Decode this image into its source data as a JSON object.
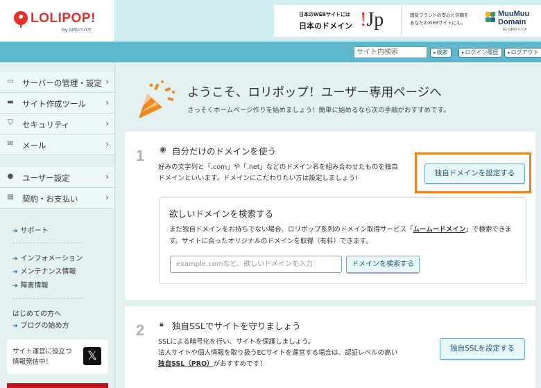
{
  "brand": {
    "logo_text": "LOLIPOP!",
    "logo_sub": "by GMOペパボ"
  },
  "banner": {
    "line1": "日本のWEBサイトには",
    "line2": "日本のドメイン",
    "jp_mark": "!Jp",
    "desc_line1": "国産ブランドの安心と信頼を",
    "desc_line2": "あなたのWEBサイトにも。",
    "sponsor": "MuuMuu Domain",
    "sponsor_sub": "by GMOペパボ"
  },
  "toolbar": {
    "search_placeholder": "サイト内検索",
    "search_button": "検索",
    "login_history": "ログイン履歴",
    "logout": "ログアウト"
  },
  "sidebar": {
    "nav": [
      {
        "label": "サーバーの管理・設定",
        "icon": "server-icon"
      },
      {
        "label": "サイト作成ツール",
        "icon": "laptop-icon"
      },
      {
        "label": "セキュリティ",
        "icon": "shield-icon"
      },
      {
        "label": "メール",
        "icon": "mail-icon"
      },
      {
        "label": "ユーザー設定",
        "icon": "user-icon"
      },
      {
        "label": "契約・お支払い",
        "icon": "card-icon"
      }
    ],
    "support": "サポート",
    "info_links": [
      "インフォメーション",
      "メンテナンス情報",
      "障害情報"
    ],
    "beginners": "はじめての方へ",
    "blog": "ブログの始め方",
    "x_promo_line1": "サイト運営に役立つ",
    "x_promo_line2": "情報発信中！",
    "x_label": "𝕏"
  },
  "welcome": {
    "title": "ようこそ、ロリポップ！ユーザー専用ページへ",
    "subtitle": "さっそくホームページ作りを始めましょう！簡単に始めるなら次の手順がおすすめです。"
  },
  "step1": {
    "number": "1",
    "title": "自分だけのドメインを使う",
    "desc_line1": "好みの文字列と「.com」や「.net」などのドメイン名を組み合わせたものを独自",
    "desc_line2": "ドメインといいます。ドメインにこだわりたい方は設定しましょう!",
    "button": "独自ドメインを設定する",
    "search_title": "欲しいドメインを検索する",
    "search_desc_pre": "まだ独自ドメインをお持ちでない場合、ロリポップ系列のドメイン取得サービス「",
    "search_desc_link": "ムームードメイン",
    "search_desc_post": "」で検索できます。サイトに合ったオリジナルのドメインを取得（有料）できます。",
    "search_placeholder": "example.comなど、欲しいドメインを入力",
    "search_button": "ドメインを検索する"
  },
  "step2": {
    "number": "2",
    "title": "独自SSLでサイトを守りましょう",
    "desc_line1": "SSLによる暗号化を行い、サイトを保護しましょう。",
    "desc_line2": "法人サイトや個人情報を取り扱うECサイトを運営する場合は、認証レベルの高い",
    "desc_link": "独自SSL（PRO）",
    "desc_line3_post": "がおすすめです！",
    "button": "独自SSLを設定する"
  },
  "colors": {
    "brand_red": "#e5302a",
    "toolbar_teal": "#5db7cd",
    "sidebar_bg": "#e3f1f0",
    "highlight_orange": "#f0821e"
  }
}
